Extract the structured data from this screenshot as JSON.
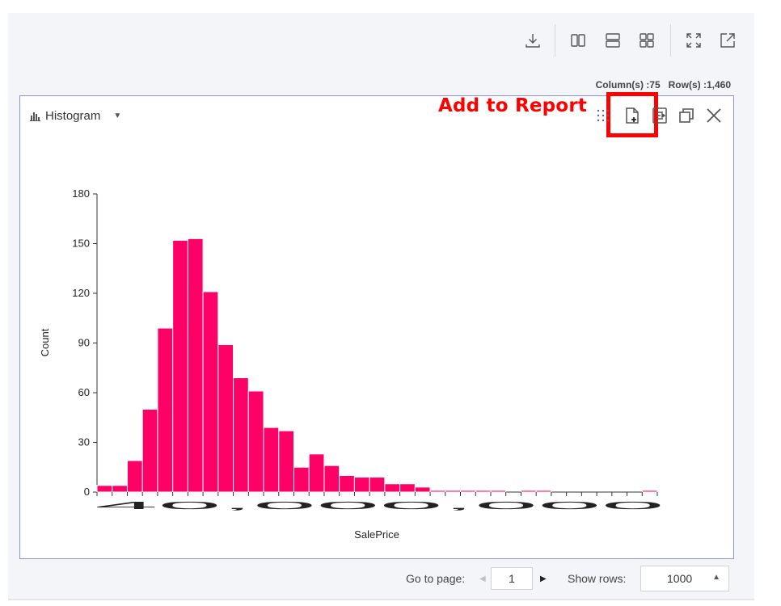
{
  "toolbar": {
    "icons": [
      "download-icon",
      "columns-layout-icon",
      "rows-layout-icon",
      "grid-layout-icon",
      "fullscreen-icon",
      "open-external-icon"
    ]
  },
  "dataset": {
    "columns_text": "Column(s) :75",
    "rows_text": "Row(s) :1,460"
  },
  "panel": {
    "chart_type_label": "Histogram",
    "annotation": "Add to Report",
    "icons": [
      "grid-dots-icon",
      "add-to-report-icon",
      "chart-report-icon",
      "copy-icon",
      "close-icon"
    ]
  },
  "colors": {
    "bar": "#ff0066",
    "annotation": "#ff0000",
    "panel_border": "#8b8ef0"
  },
  "chart_data": {
    "type": "bar",
    "xlabel": "SalePrice",
    "ylabel": "Count",
    "ylim": [
      0,
      180
    ],
    "yticks": [
      0,
      30,
      60,
      90,
      120,
      150,
      180
    ],
    "x_tick_text": "40,000,000",
    "values": [
      4,
      4,
      19,
      50,
      99,
      152,
      153,
      121,
      89,
      69,
      61,
      39,
      37,
      15,
      23,
      16,
      10,
      9,
      9,
      5,
      5,
      3,
      1,
      1,
      1,
      1,
      1,
      0,
      1,
      1,
      0,
      0,
      0,
      0,
      0,
      0,
      1
    ]
  },
  "pagination": {
    "goto_label": "Go to page:",
    "page": "1",
    "rows_label": "Show rows:",
    "rows_value": "1000"
  }
}
